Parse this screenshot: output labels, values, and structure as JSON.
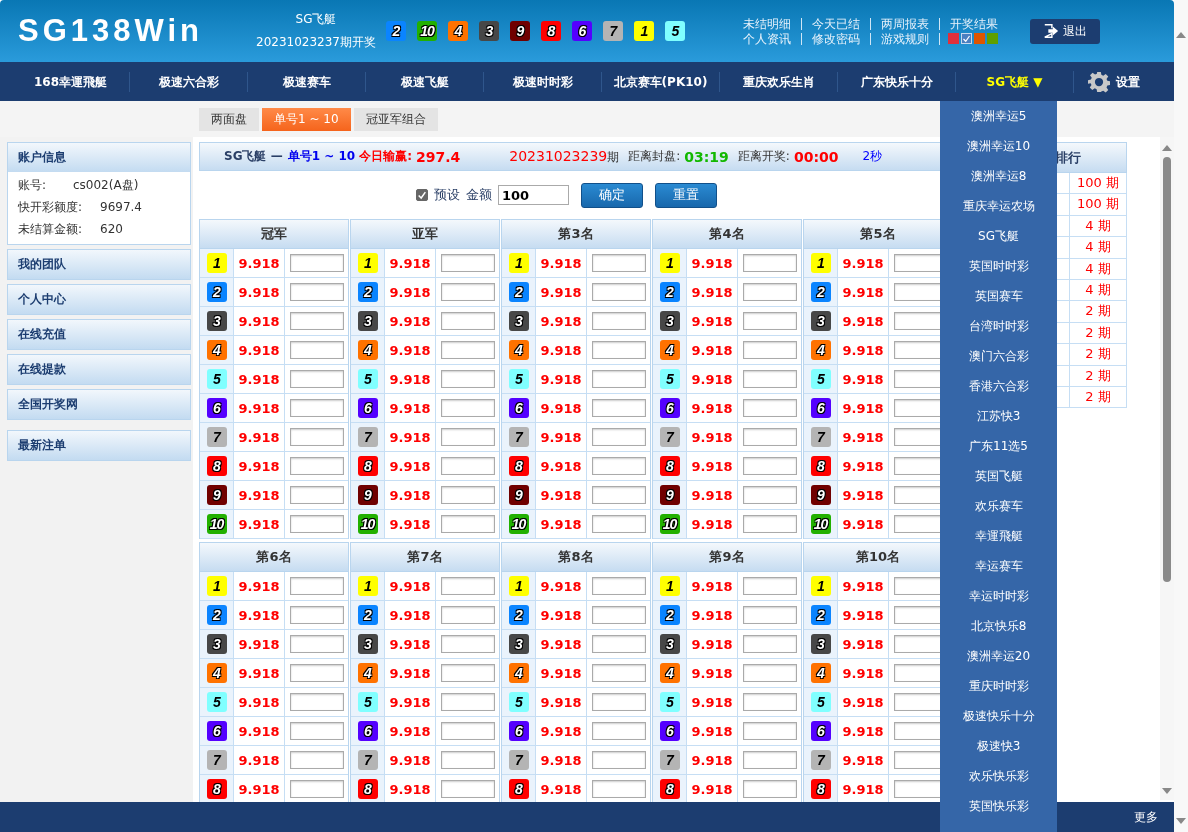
{
  "header": {
    "logo": "SG138Win",
    "game": "SG飞艇",
    "draw_issue": "20231023237期开奖",
    "balls": [
      {
        "number": "2",
        "color": "#0a84ff"
      },
      {
        "number": "10",
        "color": "#22b000"
      },
      {
        "number": "4",
        "color": "#ff7200"
      },
      {
        "number": "3",
        "color": "#474747"
      },
      {
        "number": "9",
        "color": "#700000"
      },
      {
        "number": "8",
        "color": "#ff0000"
      },
      {
        "number": "6",
        "color": "#5400ff"
      },
      {
        "number": "7",
        "color": "#b4b4b4"
      },
      {
        "number": "1",
        "color": "#ffff00"
      },
      {
        "number": "5",
        "color": "#80ffff"
      }
    ],
    "links_top": [
      "未结明细",
      "今天已结",
      "两周报表",
      "开奖结果"
    ],
    "links_bottom": [
      "个人资讯",
      "修改密码",
      "游戏规则"
    ],
    "themes": [
      {
        "color": "#e0303c",
        "selected": false
      },
      {
        "color": "#4a7fc0",
        "selected": true
      },
      {
        "color": "#dd5500",
        "selected": false
      },
      {
        "color": "#5f9f00",
        "selected": false
      }
    ],
    "logout": "退出"
  },
  "nav": [
    {
      "label": "168幸運飛艇",
      "selected": false
    },
    {
      "label": "极速六合彩",
      "selected": false
    },
    {
      "label": "极速赛车",
      "selected": false
    },
    {
      "label": "极速飞艇",
      "selected": false
    },
    {
      "label": "极速时时彩",
      "selected": false
    },
    {
      "label": "北京赛车(PK10)",
      "selected": false
    },
    {
      "label": "重庆欢乐生肖",
      "selected": false
    },
    {
      "label": "广东快乐十分",
      "selected": false
    },
    {
      "label": "SG飞艇 ▼",
      "selected": true
    }
  ],
  "settings": "设置",
  "dropdown": [
    "澳洲幸运5",
    "澳洲幸运10",
    "澳洲幸运8",
    "重庆幸运农场",
    "SG飞艇",
    "英国时时彩",
    "英国赛车",
    "台湾时时彩",
    "澳门六合彩",
    "香港六合彩",
    "江苏快3",
    "广东11选5",
    "英国飞艇",
    "欢乐赛车",
    "幸運飛艇",
    "幸运赛车",
    "幸运时时彩",
    "北京快乐8",
    "澳洲幸运20",
    "重庆时时彩",
    "极速快乐十分",
    "极速快3",
    "欢乐快乐彩",
    "英国快乐彩"
  ],
  "tabs": [
    {
      "label": "两面盘",
      "selected": false
    },
    {
      "label": "单号1 ~ 10",
      "selected": true
    },
    {
      "label": "冠亚军组合",
      "selected": false
    }
  ],
  "sidebar": {
    "account_title": "账户信息",
    "account": [
      {
        "label": "账号:",
        "value": "cs002(A盘)"
      },
      {
        "label": "快开彩额度:",
        "value": "9697.4"
      },
      {
        "label": "未结算金额:",
        "value": "620"
      }
    ],
    "menu": [
      "我的团队",
      "个人中心",
      "在线充值",
      "在线提款",
      "全国开奖网"
    ],
    "latest": "最新注单"
  },
  "info_bar": {
    "game": "SG飞艇 —",
    "play": "单号1 ~ 10",
    "profit_label": "今日输赢:",
    "profit": "297.4",
    "issue": "20231023239",
    "issue_suffix": "期",
    "close_label": "距离封盘:",
    "close_time": "03:19",
    "draw_label": "距离开奖:",
    "draw_time": "00:00",
    "refresh": "2秒"
  },
  "controls": {
    "preset_label": "预设",
    "preset_checked": true,
    "amount_label": "金额",
    "amount": "100",
    "confirm": "确定",
    "reset": "重置"
  },
  "groups": [
    {
      "columns": [
        {
          "title": "冠军",
          "rows": [
            {
              "number": "1",
              "color": "#ffff00",
              "odds": "9.918"
            },
            {
              "number": "2",
              "color": "#0a84ff",
              "odds": "9.918"
            },
            {
              "number": "3",
              "color": "#474747",
              "odds": "9.918"
            },
            {
              "number": "4",
              "color": "#ff7200",
              "odds": "9.918"
            },
            {
              "number": "5",
              "color": "#80ffff",
              "odds": "9.918"
            },
            {
              "number": "6",
              "color": "#5400ff",
              "odds": "9.918"
            },
            {
              "number": "7",
              "color": "#b4b4b4",
              "odds": "9.918"
            },
            {
              "number": "8",
              "color": "#ff0000",
              "odds": "9.918"
            },
            {
              "number": "9",
              "color": "#700000",
              "odds": "9.918"
            },
            {
              "number": "10",
              "color": "#22b000",
              "odds": "9.918"
            }
          ]
        },
        {
          "title": "亚军",
          "rows": [
            {
              "number": "1",
              "color": "#ffff00",
              "odds": "9.918"
            },
            {
              "number": "2",
              "color": "#0a84ff",
              "odds": "9.918"
            },
            {
              "number": "3",
              "color": "#474747",
              "odds": "9.918"
            },
            {
              "number": "4",
              "color": "#ff7200",
              "odds": "9.918"
            },
            {
              "number": "5",
              "color": "#80ffff",
              "odds": "9.918"
            },
            {
              "number": "6",
              "color": "#5400ff",
              "odds": "9.918"
            },
            {
              "number": "7",
              "color": "#b4b4b4",
              "odds": "9.918"
            },
            {
              "number": "8",
              "color": "#ff0000",
              "odds": "9.918"
            },
            {
              "number": "9",
              "color": "#700000",
              "odds": "9.918"
            },
            {
              "number": "10",
              "color": "#22b000",
              "odds": "9.918"
            }
          ]
        },
        {
          "title": "第3名",
          "rows": [
            {
              "number": "1",
              "color": "#ffff00",
              "odds": "9.918"
            },
            {
              "number": "2",
              "color": "#0a84ff",
              "odds": "9.918"
            },
            {
              "number": "3",
              "color": "#474747",
              "odds": "9.918"
            },
            {
              "number": "4",
              "color": "#ff7200",
              "odds": "9.918"
            },
            {
              "number": "5",
              "color": "#80ffff",
              "odds": "9.918"
            },
            {
              "number": "6",
              "color": "#5400ff",
              "odds": "9.918"
            },
            {
              "number": "7",
              "color": "#b4b4b4",
              "odds": "9.918"
            },
            {
              "number": "8",
              "color": "#ff0000",
              "odds": "9.918"
            },
            {
              "number": "9",
              "color": "#700000",
              "odds": "9.918"
            },
            {
              "number": "10",
              "color": "#22b000",
              "odds": "9.918"
            }
          ]
        },
        {
          "title": "第4名",
          "rows": [
            {
              "number": "1",
              "color": "#ffff00",
              "odds": "9.918"
            },
            {
              "number": "2",
              "color": "#0a84ff",
              "odds": "9.918"
            },
            {
              "number": "3",
              "color": "#474747",
              "odds": "9.918"
            },
            {
              "number": "4",
              "color": "#ff7200",
              "odds": "9.918"
            },
            {
              "number": "5",
              "color": "#80ffff",
              "odds": "9.918"
            },
            {
              "number": "6",
              "color": "#5400ff",
              "odds": "9.918"
            },
            {
              "number": "7",
              "color": "#b4b4b4",
              "odds": "9.918"
            },
            {
              "number": "8",
              "color": "#ff0000",
              "odds": "9.918"
            },
            {
              "number": "9",
              "color": "#700000",
              "odds": "9.918"
            },
            {
              "number": "10",
              "color": "#22b000",
              "odds": "9.918"
            }
          ]
        },
        {
          "title": "第5名",
          "rows": [
            {
              "number": "1",
              "color": "#ffff00",
              "odds": "9.918"
            },
            {
              "number": "2",
              "color": "#0a84ff",
              "odds": "9.918"
            },
            {
              "number": "3",
              "color": "#474747",
              "odds": "9.918"
            },
            {
              "number": "4",
              "color": "#ff7200",
              "odds": "9.918"
            },
            {
              "number": "5",
              "color": "#80ffff",
              "odds": "9.918"
            },
            {
              "number": "6",
              "color": "#5400ff",
              "odds": "9.918"
            },
            {
              "number": "7",
              "color": "#b4b4b4",
              "odds": "9.918"
            },
            {
              "number": "8",
              "color": "#ff0000",
              "odds": "9.918"
            },
            {
              "number": "9",
              "color": "#700000",
              "odds": "9.918"
            },
            {
              "number": "10",
              "color": "#22b000",
              "odds": "9.918"
            }
          ]
        }
      ]
    },
    {
      "columns": [
        {
          "title": "第6名",
          "rows": [
            {
              "number": "1",
              "color": "#ffff00",
              "odds": "9.918"
            },
            {
              "number": "2",
              "color": "#0a84ff",
              "odds": "9.918"
            },
            {
              "number": "3",
              "color": "#474747",
              "odds": "9.918"
            },
            {
              "number": "4",
              "color": "#ff7200",
              "odds": "9.918"
            },
            {
              "number": "5",
              "color": "#80ffff",
              "odds": "9.918"
            },
            {
              "number": "6",
              "color": "#5400ff",
              "odds": "9.918"
            },
            {
              "number": "7",
              "color": "#b4b4b4",
              "odds": "9.918"
            },
            {
              "number": "8",
              "color": "#ff0000",
              "odds": "9.918"
            }
          ]
        },
        {
          "title": "第7名",
          "rows": [
            {
              "number": "1",
              "color": "#ffff00",
              "odds": "9.918"
            },
            {
              "number": "2",
              "color": "#0a84ff",
              "odds": "9.918"
            },
            {
              "number": "3",
              "color": "#474747",
              "odds": "9.918"
            },
            {
              "number": "4",
              "color": "#ff7200",
              "odds": "9.918"
            },
            {
              "number": "5",
              "color": "#80ffff",
              "odds": "9.918"
            },
            {
              "number": "6",
              "color": "#5400ff",
              "odds": "9.918"
            },
            {
              "number": "7",
              "color": "#b4b4b4",
              "odds": "9.918"
            },
            {
              "number": "8",
              "color": "#ff0000",
              "odds": "9.918"
            }
          ]
        },
        {
          "title": "第8名",
          "rows": [
            {
              "number": "1",
              "color": "#ffff00",
              "odds": "9.918"
            },
            {
              "number": "2",
              "color": "#0a84ff",
              "odds": "9.918"
            },
            {
              "number": "3",
              "color": "#474747",
              "odds": "9.918"
            },
            {
              "number": "4",
              "color": "#ff7200",
              "odds": "9.918"
            },
            {
              "number": "5",
              "color": "#80ffff",
              "odds": "9.918"
            },
            {
              "number": "6",
              "color": "#5400ff",
              "odds": "9.918"
            },
            {
              "number": "7",
              "color": "#b4b4b4",
              "odds": "9.918"
            },
            {
              "number": "8",
              "color": "#ff0000",
              "odds": "9.918"
            }
          ]
        },
        {
          "title": "第9名",
          "rows": [
            {
              "number": "1",
              "color": "#ffff00",
              "odds": "9.918"
            },
            {
              "number": "2",
              "color": "#0a84ff",
              "odds": "9.918"
            },
            {
              "number": "3",
              "color": "#474747",
              "odds": "9.918"
            },
            {
              "number": "4",
              "color": "#ff7200",
              "odds": "9.918"
            },
            {
              "number": "5",
              "color": "#80ffff",
              "odds": "9.918"
            },
            {
              "number": "6",
              "color": "#5400ff",
              "odds": "9.918"
            },
            {
              "number": "7",
              "color": "#b4b4b4",
              "odds": "9.918"
            },
            {
              "number": "8",
              "color": "#ff0000",
              "odds": "9.918"
            }
          ]
        },
        {
          "title": "第10名",
          "rows": [
            {
              "number": "1",
              "color": "#ffff00",
              "odds": "9.918"
            },
            {
              "number": "2",
              "color": "#0a84ff",
              "odds": "9.918"
            },
            {
              "number": "3",
              "color": "#474747",
              "odds": "9.918"
            },
            {
              "number": "4",
              "color": "#ff7200",
              "odds": "9.918"
            },
            {
              "number": "5",
              "color": "#80ffff",
              "odds": "9.918"
            },
            {
              "number": "6",
              "color": "#5400ff",
              "odds": "9.918"
            },
            {
              "number": "7",
              "color": "#b4b4b4",
              "odds": "9.918"
            },
            {
              "number": "8",
              "color": "#ff0000",
              "odds": "9.918"
            }
          ]
        }
      ]
    }
  ],
  "ranking": {
    "title": "排行",
    "rows": [
      "100 期",
      "100 期",
      "4 期",
      "4 期",
      "4 期",
      "4 期",
      "2 期",
      "2 期",
      "2 期",
      "2 期",
      "2 期"
    ]
  },
  "footer": {
    "more": "更多"
  }
}
